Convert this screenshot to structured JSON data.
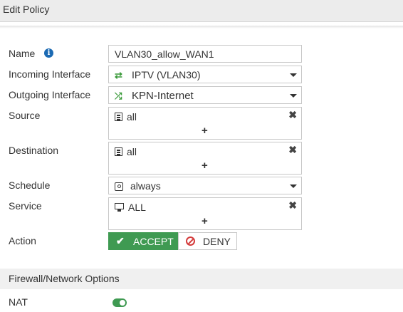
{
  "header": {
    "title": "Edit Policy"
  },
  "form": {
    "name": {
      "label": "Name",
      "value": "VLAN30_allow_WAN1"
    },
    "incoming": {
      "label": "Incoming Interface",
      "value": "IPTV (VLAN30)",
      "icon": "vlan-icon"
    },
    "outgoing": {
      "label": "Outgoing Interface",
      "value": "KPN-Internet",
      "icon": "sd-wan-icon"
    },
    "source": {
      "label": "Source",
      "entry": "all",
      "add": "+"
    },
    "destination": {
      "label": "Destination",
      "entry": "all",
      "add": "+"
    },
    "schedule": {
      "label": "Schedule",
      "value": "always"
    },
    "service": {
      "label": "Service",
      "entry": "ALL",
      "add": "+"
    },
    "action": {
      "label": "Action",
      "accept": "ACCEPT",
      "deny": "DENY",
      "selected": "ACCEPT"
    }
  },
  "firewall_section": {
    "title": "Firewall/Network Options"
  },
  "nat": {
    "label": "NAT",
    "enabled": true
  },
  "colors": {
    "accent_green": "#3f9a52",
    "deny_red": "#d43b3b",
    "info_blue": "#1b6ab3"
  }
}
